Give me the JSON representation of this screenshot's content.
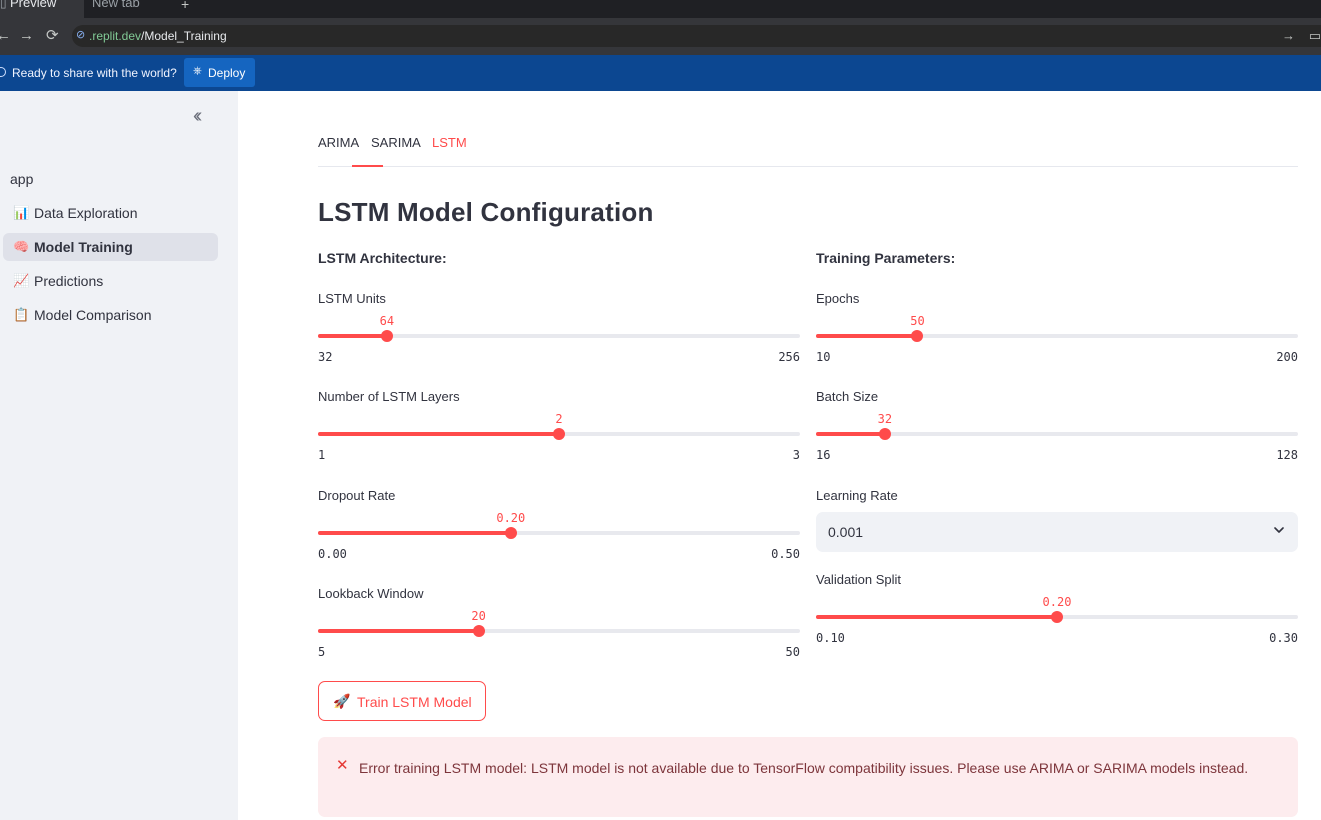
{
  "browser": {
    "active_tab": "Preview",
    "other_tab": "New tab",
    "url_host": ".replit.dev",
    "url_path": "/Model_Training"
  },
  "deploy_bar": {
    "message": "Ready to share with the world?",
    "button_label": "Deploy"
  },
  "sidebar": {
    "section_label": "app",
    "items": [
      {
        "icon": "📊",
        "label": "Data Exploration",
        "active": false
      },
      {
        "icon": "🧠",
        "label": "Model Training",
        "active": true
      },
      {
        "icon": "📈",
        "label": "Predictions",
        "active": false
      },
      {
        "icon": "📋",
        "label": "Model Comparison",
        "active": false
      }
    ]
  },
  "tabs": [
    {
      "label": "ARIMA",
      "active": false
    },
    {
      "label": "SARIMA",
      "active": false
    },
    {
      "label": "LSTM",
      "active": true
    }
  ],
  "page_title": "LSTM Model Configuration",
  "architecture": {
    "heading": "LSTM Architecture:",
    "lstm_units": {
      "label": "LSTM Units",
      "value": "64",
      "min": "32",
      "max": "256"
    },
    "layers": {
      "label": "Number of LSTM Layers",
      "value": "2",
      "min": "1",
      "max": "3"
    },
    "dropout": {
      "label": "Dropout Rate",
      "value": "0.20",
      "min": "0.00",
      "max": "0.50"
    },
    "lookback": {
      "label": "Lookback Window",
      "value": "20",
      "min": "5",
      "max": "50"
    }
  },
  "training": {
    "heading": "Training Parameters:",
    "epochs": {
      "label": "Epochs",
      "value": "50",
      "min": "10",
      "max": "200"
    },
    "batch_size": {
      "label": "Batch Size",
      "value": "32",
      "min": "16",
      "max": "128"
    },
    "learning_rate": {
      "label": "Learning Rate",
      "value": "0.001"
    },
    "validation_split": {
      "label": "Validation Split",
      "value": "0.20",
      "min": "0.10",
      "max": "0.30"
    }
  },
  "train_button": {
    "icon": "🚀",
    "label": "Train LSTM Model"
  },
  "error": {
    "icon": "✕",
    "message": "Error training LSTM model: LSTM model is not available due to TensorFlow compatibility issues. Please use ARIMA or SARIMA models instead."
  },
  "colors": {
    "accent": "#ff4b4b",
    "sidebar_bg": "#f0f2f6",
    "deploy_bar": "#0c4791",
    "error_bg": "#fdecee"
  }
}
